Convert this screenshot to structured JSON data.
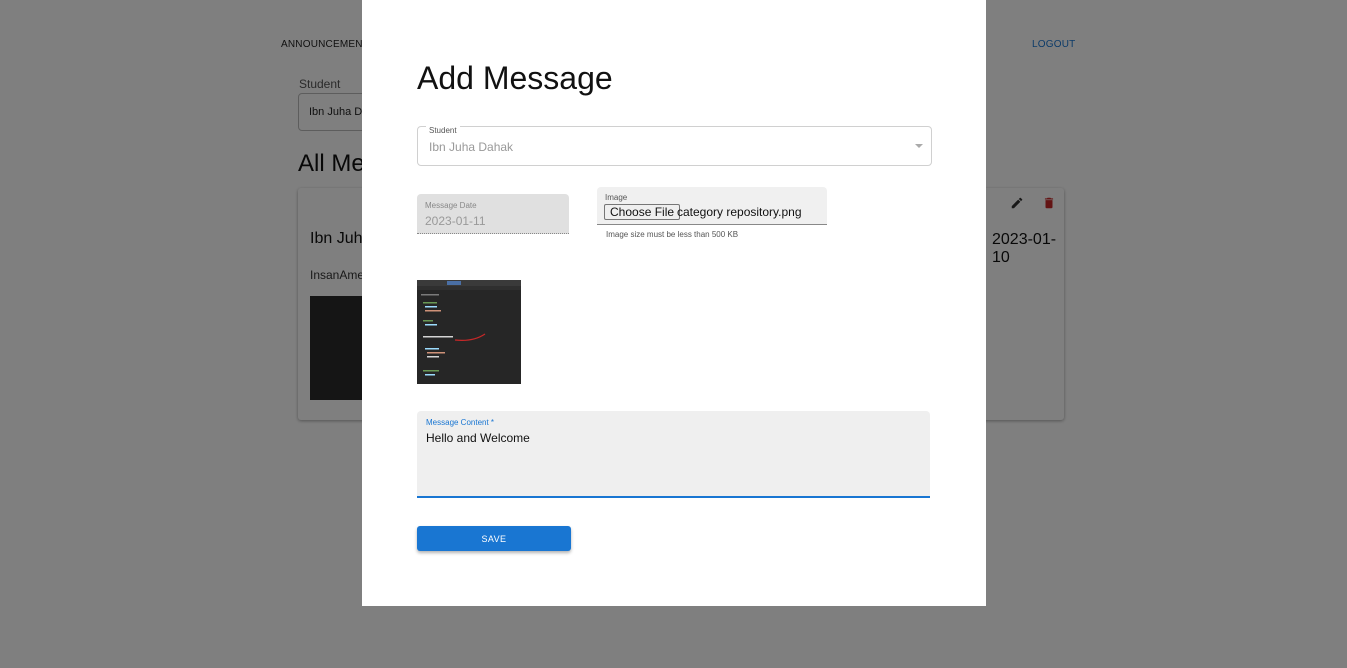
{
  "nav": {
    "announcements": "ANNOUNCEMENTS",
    "logout": "LOGOUT"
  },
  "background": {
    "student_label": "Student",
    "student_value": "Ibn Juha Dahak",
    "heading": "All Messages",
    "card": {
      "name": "Ibn Juha Dahak",
      "author": "InsanAmeer",
      "date": "2023-01-10",
      "edit_icon": "pencil-icon",
      "delete_icon": "trash-icon"
    }
  },
  "modal": {
    "title": "Add Message",
    "student": {
      "label": "Student",
      "value": "Ibn Juha Dahak"
    },
    "date": {
      "label": "Message Date",
      "value": "2023-01-11"
    },
    "image": {
      "label": "Image",
      "choose_label": "Choose File",
      "file_name": "category repository.png",
      "helper": "Image size must be less than 500 KB"
    },
    "content": {
      "label": "Message Content *",
      "value": "Hello and Welcome"
    },
    "save_label": "SAVE"
  },
  "colors": {
    "primary": "#1976d2",
    "danger": "#c62828",
    "overlay": "rgba(0,0,0,0.5)"
  }
}
